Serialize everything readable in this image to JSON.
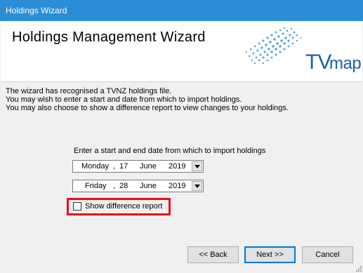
{
  "window": {
    "title": "Holdings Wizard"
  },
  "banner": {
    "heading": "Holdings Management Wizard",
    "logo_tv": "TV",
    "logo_map": "map",
    "logo_color": "#1d5fa6"
  },
  "intro": {
    "lines": [
      "The wizard has recognised a TVNZ holdings file.",
      "You may wish to enter a start and date from which to import holdings.",
      "You may also choose to show a difference report to view changes to your holdings."
    ]
  },
  "dates": {
    "prompt": "Enter a start and end date from which to import holdings",
    "start": {
      "weekday": "Monday",
      "day": "17",
      "month": "June",
      "year": "2019"
    },
    "end": {
      "weekday": "Friday",
      "day": "28",
      "month": "June",
      "year": "2019"
    },
    "separator": ","
  },
  "options": {
    "show_difference_label": "Show difference report",
    "show_difference_checked": false,
    "highlight_color": "#e8101a"
  },
  "buttons": {
    "back": "<< Back",
    "next": "Next >>",
    "cancel": "Cancel"
  }
}
